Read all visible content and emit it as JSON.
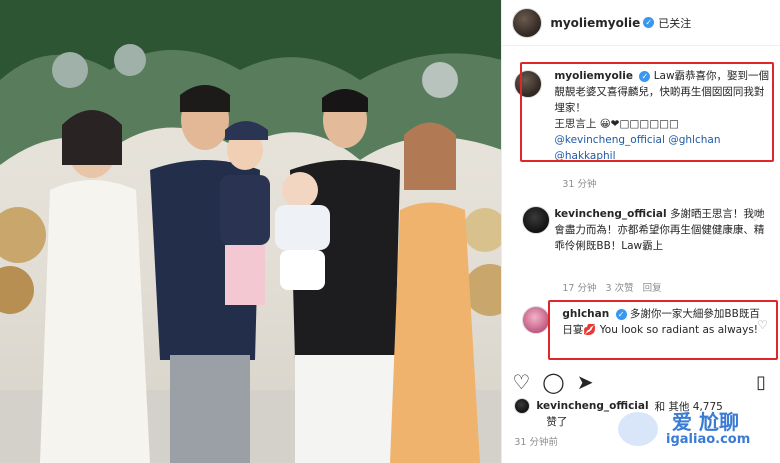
{
  "header": {
    "username": "myoliemyolie",
    "follow": "已关注"
  },
  "comment1": {
    "username": "myoliemyolie",
    "text": "Law霸恭喜你，娶到一個靚靚老婆又喜得麟兒，快啲再生個囡囡同我對埋家！",
    "line2": "王思言上 😀❤︎□□□□□□",
    "tags1": "@kevincheng_official @ghlchan",
    "tags2": "@hakkaphil",
    "time": "31 分钟"
  },
  "comment2": {
    "username": "kevincheng_official",
    "text": "多謝晒王思言！我哋會盡力而為！亦都希望你再生個健健康康、精乖伶俐既BB！Law霸上",
    "time": "17 分钟",
    "likes": "3 次赞",
    "reply": "回复"
  },
  "comment3": {
    "username": "ghlchan",
    "text": "多謝你一家大細參加BB既百日宴💋 You look so radiant as always!"
  },
  "likes": {
    "user": "kevincheng_official",
    "text": "和 其他 4,775",
    "line2": "赞了"
  },
  "post_time": "31 分钟前",
  "watermark": {
    "line1": "爱 尬聊",
    "line2": "igaliao.com"
  }
}
